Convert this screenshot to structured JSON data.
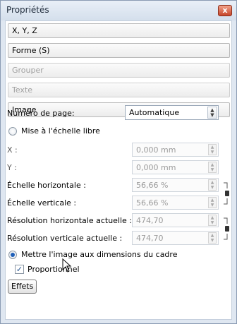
{
  "window": {
    "title": "Propriétés",
    "close_glyph": "x"
  },
  "sections": {
    "xyz": "X, Y, Z",
    "shape": "Forme (S)",
    "group": "Grouper",
    "text": "Texte",
    "image": "Image"
  },
  "image": {
    "page_number_label": "Numéro de page:",
    "page_number_value": "Automatique",
    "free_scale_label": "Mise à l'échelle libre",
    "x_label": "X :",
    "x_value": "0,000 mm",
    "y_label": "Y :",
    "y_value": "0,000 mm",
    "hscale_label": "Échelle horizontale :",
    "hscale_value": "56,66 %",
    "vscale_label": "Échelle verticale :",
    "vscale_value": "56,66 %",
    "hres_label": "Résolution horizontale actuelle :",
    "hres_value": "474,70",
    "vres_label": "Résolution verticale actuelle :",
    "vres_value": "474,70",
    "fit_frame_label": "Mettre l'image aux dimensions du cadre",
    "proportional_label": "Proportionnel",
    "effects_button": "Effets"
  },
  "state": {
    "free_scale_selected": false,
    "fit_frame_selected": true,
    "proportional_checked": true
  },
  "icons": {
    "close": "close-icon",
    "spin_arrows": "spin-arrows-icon",
    "chain_link": "chain-link-icon",
    "cursor": "mouse-pointer-icon"
  },
  "colors": {
    "window_frame": "#dfe7f1",
    "close_red": "#c6452a",
    "radio_dot": "#1e5fb8"
  }
}
